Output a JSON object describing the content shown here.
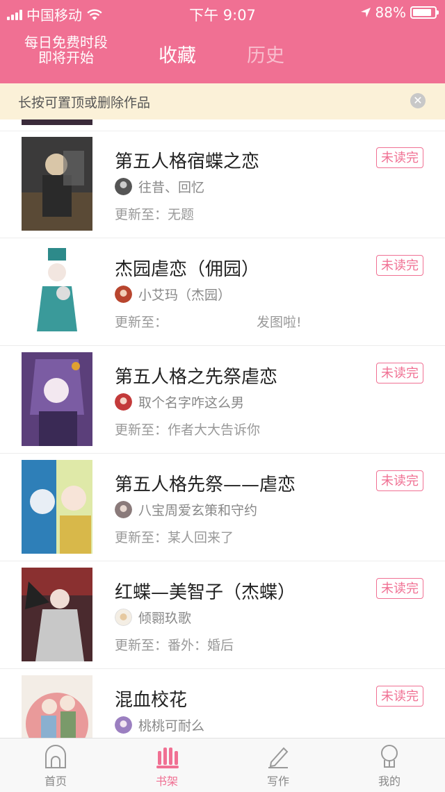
{
  "status_bar": {
    "carrier": "中国移动",
    "time": "下午 9:07",
    "battery_text": "88%",
    "battery_level": 0.88
  },
  "header": {
    "promo_line1": "每日免费时段",
    "promo_line2": "即将开始",
    "tabs": [
      {
        "label": "收藏",
        "active": true
      },
      {
        "label": "历史",
        "active": false
      }
    ],
    "background_color": "#f07093"
  },
  "notice": {
    "text": "长按可置顶或删除作品",
    "close_icon": "close-icon"
  },
  "items": [
    {
      "title": "第五人格宿蝶之恋",
      "author": "往昔、回忆",
      "update_label": "更新至：",
      "update_value": "无题",
      "badge": "未读完"
    },
    {
      "title": "杰园虐恋（佣园）",
      "author": "小艾玛（杰园）",
      "update_label": "更新至：",
      "update_value": "发图啦!",
      "badge": "未读完"
    },
    {
      "title": "第五人格之先祭虐恋",
      "author": "取个名字咋这么男",
      "update_label": "更新至：",
      "update_value": "作者大大告诉你",
      "badge": "未读完"
    },
    {
      "title": "第五人格先祭——虐恋",
      "author": "八宝周爱玄策和守约",
      "update_label": "更新至：",
      "update_value": "某人回来了",
      "badge": "未读完"
    },
    {
      "title": "红蝶—美智子（杰蝶）",
      "author": "倾翾玖歌",
      "update_label": "更新至：",
      "update_value": "番外：婚后",
      "badge": "未读完"
    },
    {
      "title": "混血校花",
      "author": "桃桃可耐么",
      "update_label": "",
      "update_value": "",
      "badge": "未读完"
    }
  ],
  "tabbar": [
    {
      "label": "首页",
      "icon": "home-icon",
      "active": false
    },
    {
      "label": "书架",
      "icon": "bookshelf-icon",
      "active": true
    },
    {
      "label": "写作",
      "icon": "pencil-icon",
      "active": false
    },
    {
      "label": "我的",
      "icon": "profile-icon",
      "active": false
    }
  ],
  "colors": {
    "accent": "#f07093",
    "notice_bg": "#fbf1d8"
  }
}
